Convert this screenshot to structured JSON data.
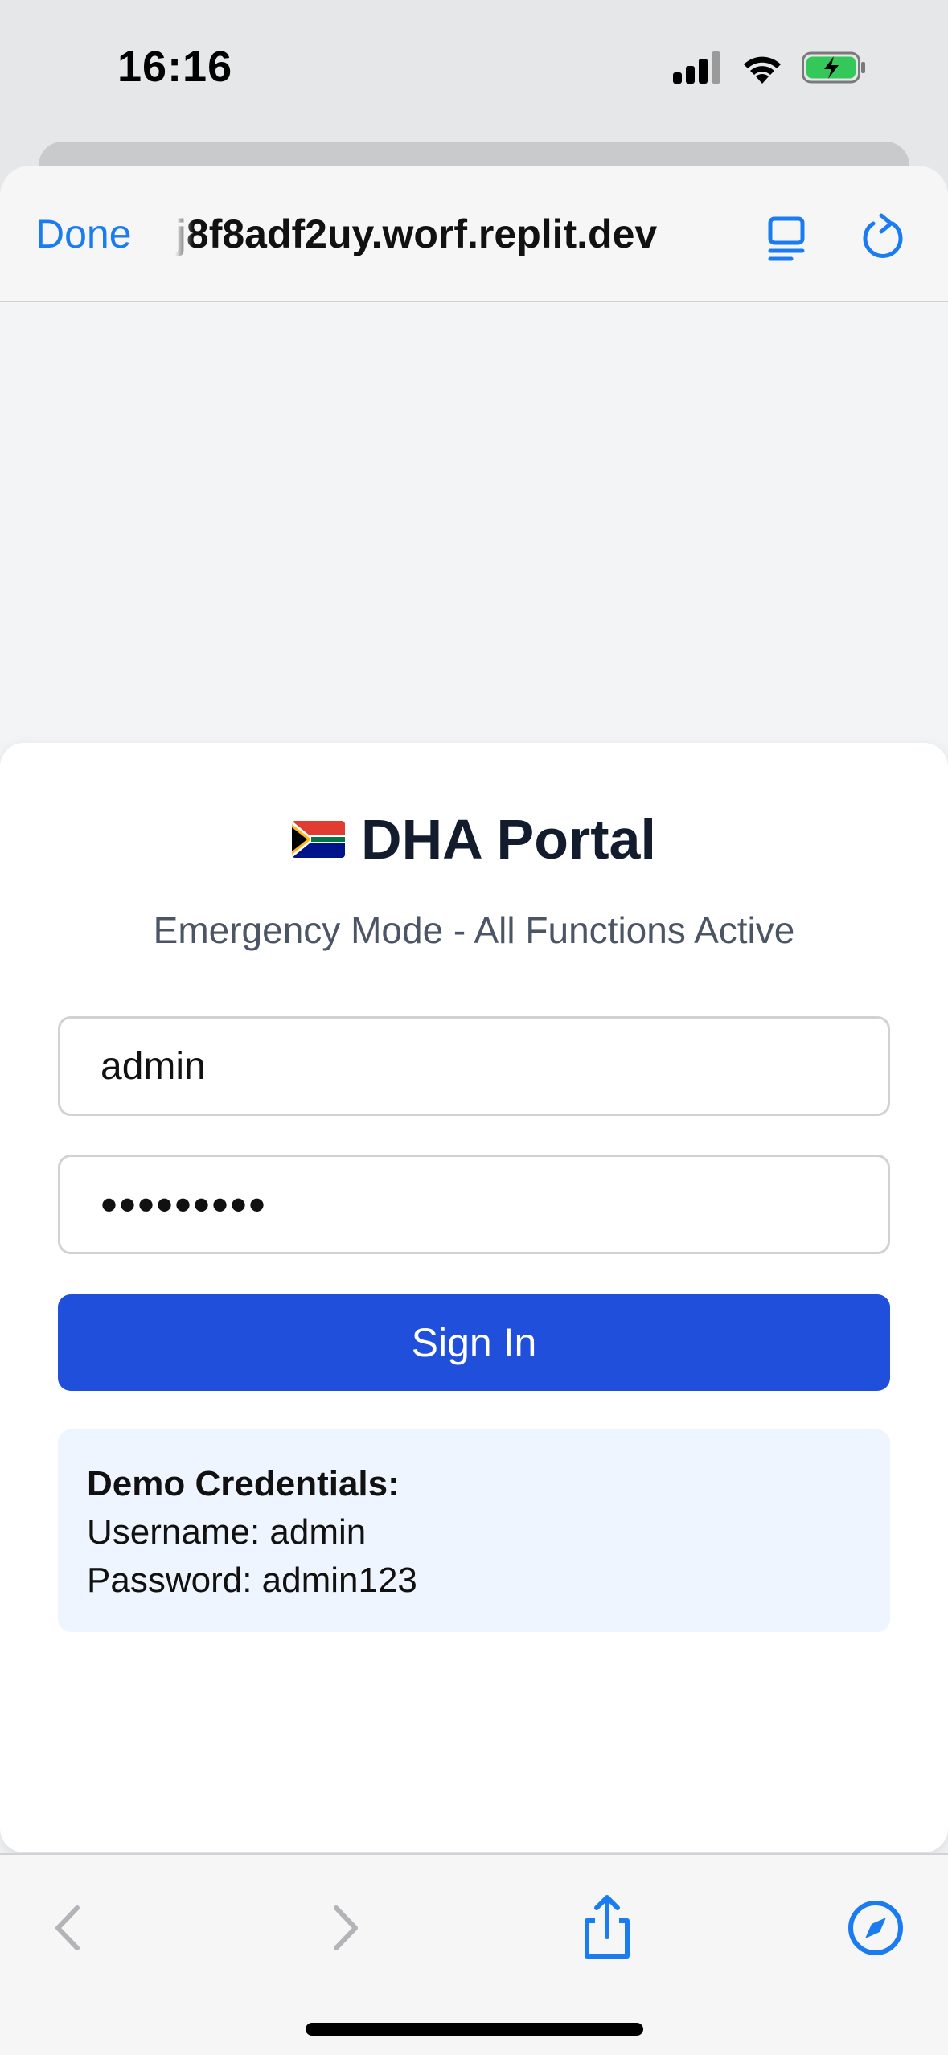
{
  "status_bar": {
    "time": "16:16"
  },
  "browser": {
    "done_label": "Done",
    "url": "j8f8adf2uy.worf.replit.dev",
    "accent_color": "#1a7cf0",
    "icons": [
      "reader-icon",
      "reload-icon"
    ]
  },
  "login": {
    "flag": "south-africa-flag",
    "title": "DHA Portal",
    "subtitle": "Emergency Mode - All Functions Active",
    "username_value": "admin",
    "password_value": "•••••••••",
    "signin_label": "Sign In",
    "button_color": "#1f4fdb",
    "demo": {
      "heading": "Demo Credentials:",
      "username_line": "Username: admin",
      "password_line": "Password: admin123"
    }
  },
  "toolbar": {
    "icons": [
      "back-icon",
      "forward-icon",
      "share-icon",
      "compass-icon"
    ]
  }
}
